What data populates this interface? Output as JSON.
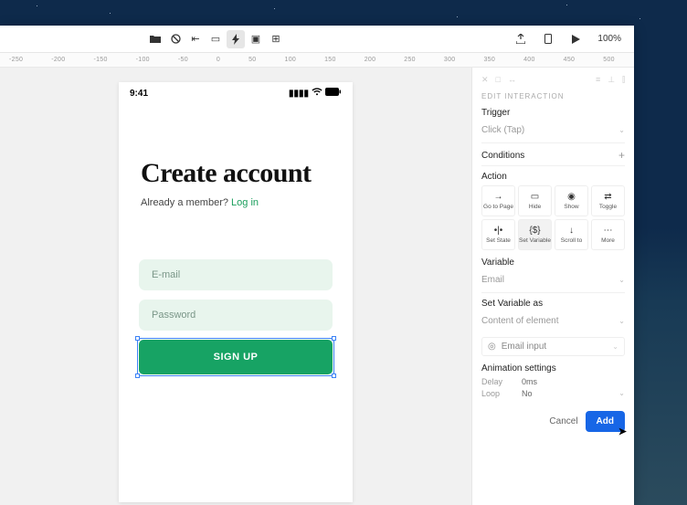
{
  "topbar": {
    "zoom": "100%"
  },
  "ruler": [
    "-250",
    "-200",
    "-150",
    "-100",
    "-50",
    "0",
    "50",
    "100",
    "150",
    "200",
    "250",
    "300",
    "350",
    "400",
    "450",
    "500"
  ],
  "artboard": {
    "time": "9:41",
    "heading": "Create account",
    "sub_prefix": "Already a member? ",
    "sub_link": "Log in",
    "email_placeholder": "E-mail",
    "password_placeholder": "Password",
    "signup_label": "SIGN UP"
  },
  "panel": {
    "header": "EDIT INTERACTION",
    "trigger_label": "Trigger",
    "trigger_value": "Click (Tap)",
    "conditions_label": "Conditions",
    "action_label": "Action",
    "actions": [
      {
        "label": "Go to Page",
        "icon": "→"
      },
      {
        "label": "Hide",
        "icon": "▭"
      },
      {
        "label": "Show",
        "icon": "◉"
      },
      {
        "label": "Toggle",
        "icon": "⇄"
      },
      {
        "label": "Set State",
        "icon": "•|•"
      },
      {
        "label": "Set Variable",
        "icon": "{$}"
      },
      {
        "label": "Scroll to",
        "icon": "↓"
      },
      {
        "label": "More",
        "icon": "⋯"
      }
    ],
    "variable_label": "Variable",
    "variable_value": "Email",
    "setvar_label": "Set Variable as",
    "setvar_value": "Content of element",
    "element_value": "Email input",
    "anim_label": "Animation settings",
    "delay_label": "Delay",
    "delay_value": "0ms",
    "loop_label": "Loop",
    "loop_value": "No",
    "cancel": "Cancel",
    "add": "Add"
  }
}
